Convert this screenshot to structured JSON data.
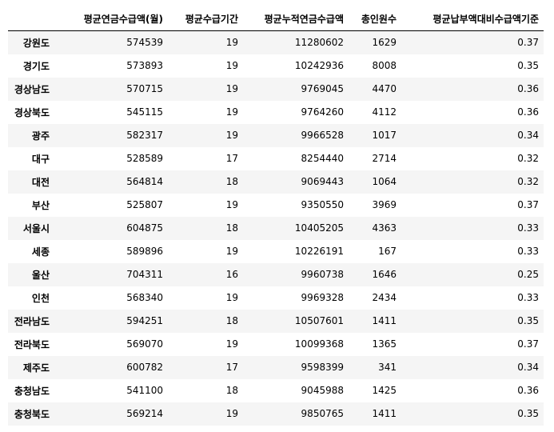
{
  "table": {
    "index_header": "",
    "columns": [
      "평균연금수급액(월)",
      "평균수급기간",
      "평균누적연금수급액",
      "총인원수",
      "평균납부액대비수급액기준"
    ],
    "rows": [
      {
        "region": "강원도",
        "values": [
          "574539",
          "19",
          "11280602",
          "1629",
          "0.37"
        ]
      },
      {
        "region": "경기도",
        "values": [
          "573893",
          "19",
          "10242936",
          "8008",
          "0.35"
        ]
      },
      {
        "region": "경상남도",
        "values": [
          "570715",
          "19",
          "9769045",
          "4470",
          "0.36"
        ]
      },
      {
        "region": "경상북도",
        "values": [
          "545115",
          "19",
          "9764260",
          "4112",
          "0.36"
        ]
      },
      {
        "region": "광주",
        "values": [
          "582317",
          "19",
          "9966528",
          "1017",
          "0.34"
        ]
      },
      {
        "region": "대구",
        "values": [
          "528589",
          "17",
          "8254440",
          "2714",
          "0.32"
        ]
      },
      {
        "region": "대전",
        "values": [
          "564814",
          "18",
          "9069443",
          "1064",
          "0.32"
        ]
      },
      {
        "region": "부산",
        "values": [
          "525807",
          "19",
          "9350550",
          "3969",
          "0.37"
        ]
      },
      {
        "region": "서울시",
        "values": [
          "604875",
          "18",
          "10405205",
          "4363",
          "0.33"
        ]
      },
      {
        "region": "세종",
        "values": [
          "589896",
          "19",
          "10226191",
          "167",
          "0.33"
        ]
      },
      {
        "region": "울산",
        "values": [
          "704311",
          "16",
          "9960738",
          "1646",
          "0.25"
        ]
      },
      {
        "region": "인천",
        "values": [
          "568340",
          "19",
          "9969328",
          "2434",
          "0.33"
        ]
      },
      {
        "region": "전라남도",
        "values": [
          "594251",
          "18",
          "10507601",
          "1411",
          "0.35"
        ]
      },
      {
        "region": "전라북도",
        "values": [
          "569070",
          "19",
          "10099368",
          "1365",
          "0.37"
        ]
      },
      {
        "region": "제주도",
        "values": [
          "600782",
          "17",
          "9598399",
          "341",
          "0.34"
        ]
      },
      {
        "region": "충청남도",
        "values": [
          "541100",
          "18",
          "9045988",
          "1425",
          "0.36"
        ]
      },
      {
        "region": "충청북도",
        "values": [
          "569214",
          "19",
          "9850765",
          "1411",
          "0.35"
        ]
      }
    ]
  }
}
